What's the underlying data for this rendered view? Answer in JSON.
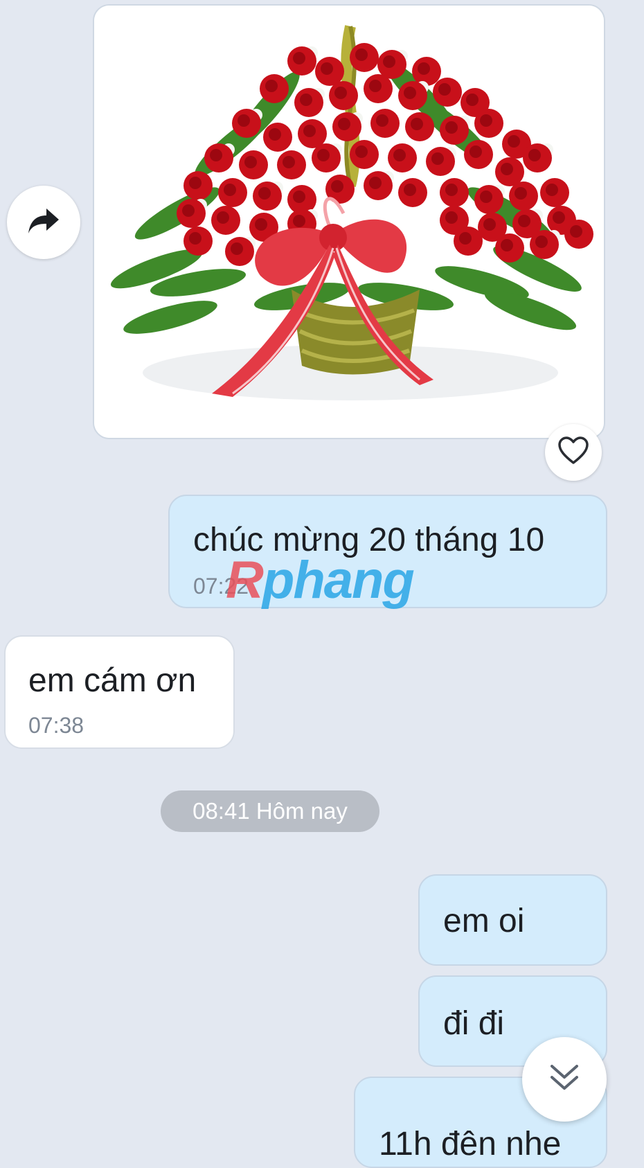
{
  "image_message": {
    "image_alt": "basket of red roses with red ribbon",
    "colors": {
      "rose": "#c8101a",
      "ribbon": "#e33a45",
      "leaf": "#3f8a2a",
      "basket": "#8a8a2a"
    }
  },
  "actions": {
    "forward_icon": "share-arrow-icon",
    "like_icon": "heart-outline-icon",
    "scroll_down_icon": "double-chevron-down-icon"
  },
  "messages": [
    {
      "text": "chúc mừng 20 tháng 10",
      "time": "07:22",
      "side": "sent"
    },
    {
      "text": "em cám ơn",
      "time": "07:38",
      "side": "received"
    },
    {
      "text": "em oi",
      "side": "sent"
    },
    {
      "text": "đi đi",
      "side": "sent"
    },
    {
      "text": "11h đên nhe",
      "side": "sent"
    }
  ],
  "date_separator": "08:41 Hôm nay",
  "watermark": {
    "first_letter": "R",
    "rest": "phang"
  },
  "colors": {
    "background": "#e3e8f1",
    "sent_bubble": "#d4ecfc",
    "received_bubble": "#ffffff",
    "time_text": "#7d8794",
    "pill": "#b9bec6"
  }
}
